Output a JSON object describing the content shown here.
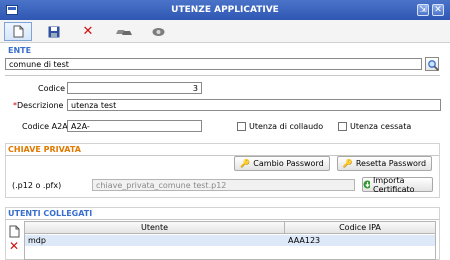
{
  "window": {
    "title": "UTENZE APPLICATIVE",
    "close_glyph": "✕"
  },
  "toolbar": {
    "items": [
      "new-icon",
      "save-icon",
      "delete-icon",
      "cars-icon",
      "lock-icon"
    ]
  },
  "ente": {
    "section_title": "ENTE",
    "name_value": "comune di test",
    "codice_label": "Codice",
    "codice_value": "3",
    "descrizione_label": "*Descrizione",
    "descrizione_value": "utenza test",
    "codice_a2a_label": "Codice A2A",
    "codice_a2a_value": "A2A-",
    "collaudo_label": "Utenza di collaudo",
    "cessata_label": "Utenza cessata"
  },
  "chiave": {
    "section_title": "CHIAVE PRIVATA",
    "cambio_password": "Cambio Password",
    "resetta_password": "Resetta Password",
    "file_label": "(.p12 o .pfx)",
    "file_value": "chiave_privata_comune test.p12",
    "importa_certificato": "Importa Certificato"
  },
  "utenti": {
    "section_title": "UTENTI COLLEGATI",
    "columns": [
      "Utente",
      "Codice IPA"
    ],
    "rows": [
      {
        "utente": "mdp",
        "codice_ipa": "AAA123"
      }
    ]
  },
  "colors": {
    "titlebar": "#3a62c0",
    "section_orange": "#e07a00",
    "section_blue": "#3a6fd0",
    "required": "#cc0000"
  }
}
